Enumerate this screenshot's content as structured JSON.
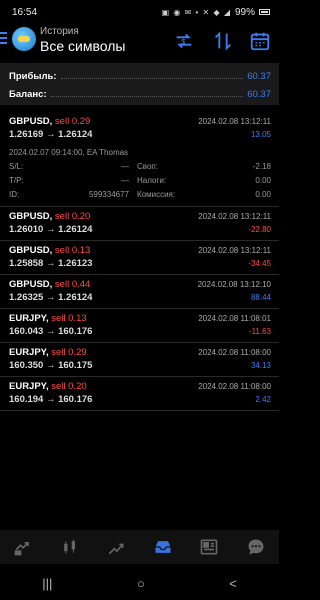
{
  "status_bar": {
    "time": "16:54",
    "battery": "99%"
  },
  "header": {
    "subtitle": "История",
    "title": "Все символы"
  },
  "summary": {
    "profit_label": "Прибыль:",
    "profit_value": "60.37",
    "balance_label": "Баланс:",
    "balance_value": "60.37"
  },
  "details_labels": {
    "sl": "S/L:",
    "tp": "T/P:",
    "id": "ID:",
    "swap": "Своп:",
    "taxes": "Налоги:",
    "commission": "Комиссия:"
  },
  "deals": [
    {
      "symbol": "GBPUSD,",
      "side": " sell 0.29",
      "prices": "1.26169 → 1.26124",
      "time": "2024.02.08 13:12:11",
      "profit": "13.05",
      "sign": "pos",
      "details": {
        "opened": "2024.02.07 09:14:00, EA Thomas",
        "sl": "—",
        "tp": "—",
        "id": "599334677",
        "swap": "-2.18",
        "taxes": "0.00",
        "commission": "0.00"
      }
    },
    {
      "symbol": "GBPUSD,",
      "side": " sell 0.20",
      "prices": "1.26010 → 1.26124",
      "time": "2024.02.08 13:12:11",
      "profit": "-22.80",
      "sign": "neg"
    },
    {
      "symbol": "GBPUSD,",
      "side": " sell 0.13",
      "prices": "1.25858 → 1.26123",
      "time": "2024.02.08 13:12:11",
      "profit": "-34.45",
      "sign": "neg"
    },
    {
      "symbol": "GBPUSD,",
      "side": " sell 0.44",
      "prices": "1.26325 → 1.26124",
      "time": "2024.02.08 13:12:10",
      "profit": "88.44",
      "sign": "pos"
    },
    {
      "symbol": "EURJPY,",
      "side": " sell 0.13",
      "prices": "160.043 → 160.176",
      "time": "2024.02.08 11:08:01",
      "profit": "-11.63",
      "sign": "neg"
    },
    {
      "symbol": "EURJPY,",
      "side": " sell 0.29",
      "prices": "160.350 → 160.175",
      "time": "2024.02.08 11:08:00",
      "profit": "34.13",
      "sign": "pos"
    },
    {
      "symbol": "EURJPY,",
      "side": " sell 0.20",
      "prices": "160.194 → 160.176",
      "time": "2024.02.08 11:08:00",
      "profit": "2.42",
      "sign": "pos"
    }
  ],
  "colors": {
    "accent": "#3d7ef5",
    "negative": "#ff4a4a",
    "background": "#000000"
  },
  "bottom_nav": [
    "quotes-icon",
    "chart-icon",
    "trade-icon",
    "history-icon",
    "news-icon",
    "messages-icon"
  ],
  "active_tab": "history-icon",
  "system_nav": {
    "recent": "|||",
    "home": "○",
    "back": "<"
  }
}
